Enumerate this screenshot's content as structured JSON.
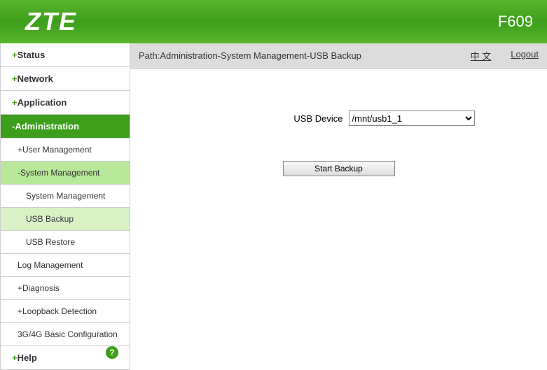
{
  "header": {
    "logo": "ZTE",
    "model": "F609"
  },
  "pathbar": {
    "path": "Path:Administration-System Management-USB Backup",
    "lang_link": "中 文",
    "logout": "Logout"
  },
  "sidebar": {
    "status": "Status",
    "network": "Network",
    "application": "Application",
    "administration": "-Administration",
    "user_mgmt": "+User Management",
    "sys_mgmt": "-System Management",
    "sys_mgmt_sub": "System Management",
    "usb_backup": "USB Backup",
    "usb_restore": "USB Restore",
    "log_mgmt": "Log Management",
    "diagnosis": "+Diagnosis",
    "loopback": "+Loopback Detection",
    "g3g4g": "3G/4G Basic Configuration",
    "help": "Help",
    "help_icon": "?"
  },
  "form": {
    "usb_device_label": "USB Device",
    "usb_device_value": "/mnt/usb1_1",
    "start_backup": "Start Backup"
  }
}
